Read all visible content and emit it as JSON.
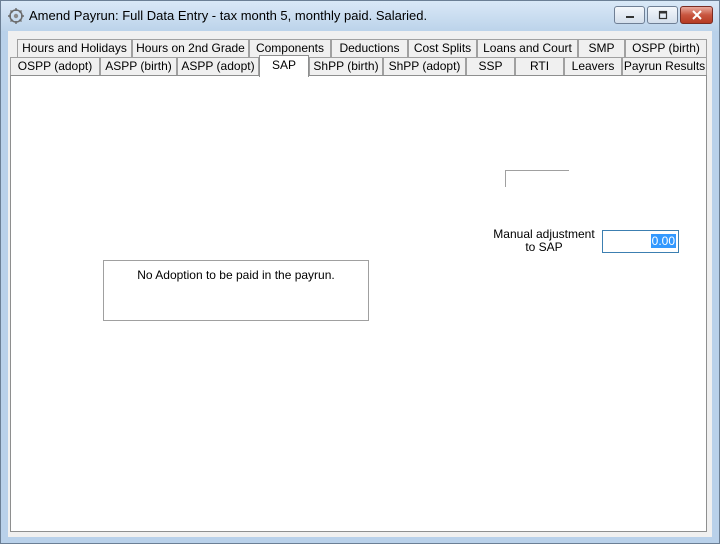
{
  "window": {
    "title": "Amend Payrun: Full Data Entry - tax month 5, monthly paid.  Salaried.",
    "icon": "payroll-app-icon",
    "controls": [
      "minimize-icon",
      "restore-icon",
      "close-icon"
    ]
  },
  "tabs": {
    "row1": [
      "Hours and Holidays",
      "Hours on 2nd Grade",
      "Components",
      "Deductions",
      "Cost Splits",
      "Loans and Court",
      "SMP",
      "OSPP (birth)"
    ],
    "row2": [
      "OSPP (adopt)",
      "ASPP (birth)",
      "ASPP (adopt)",
      "SAP",
      "ShPP (birth)",
      "ShPP (adopt)",
      "SSP",
      "RTI",
      "Leavers",
      "Payrun Results"
    ],
    "active": "SAP"
  },
  "sap": {
    "manual_adjustment_label": "Manual adjustment to SAP",
    "manual_adjustment_value": "0.00",
    "no_adoption_message": "No Adoption to be paid in the payrun."
  },
  "colors": {
    "title_bar": "#bcd3ea",
    "panel_bg": "#ffffff",
    "client_bg": "#f0f0f0",
    "selection": "#3399ff",
    "close_button": "#c8553f"
  }
}
